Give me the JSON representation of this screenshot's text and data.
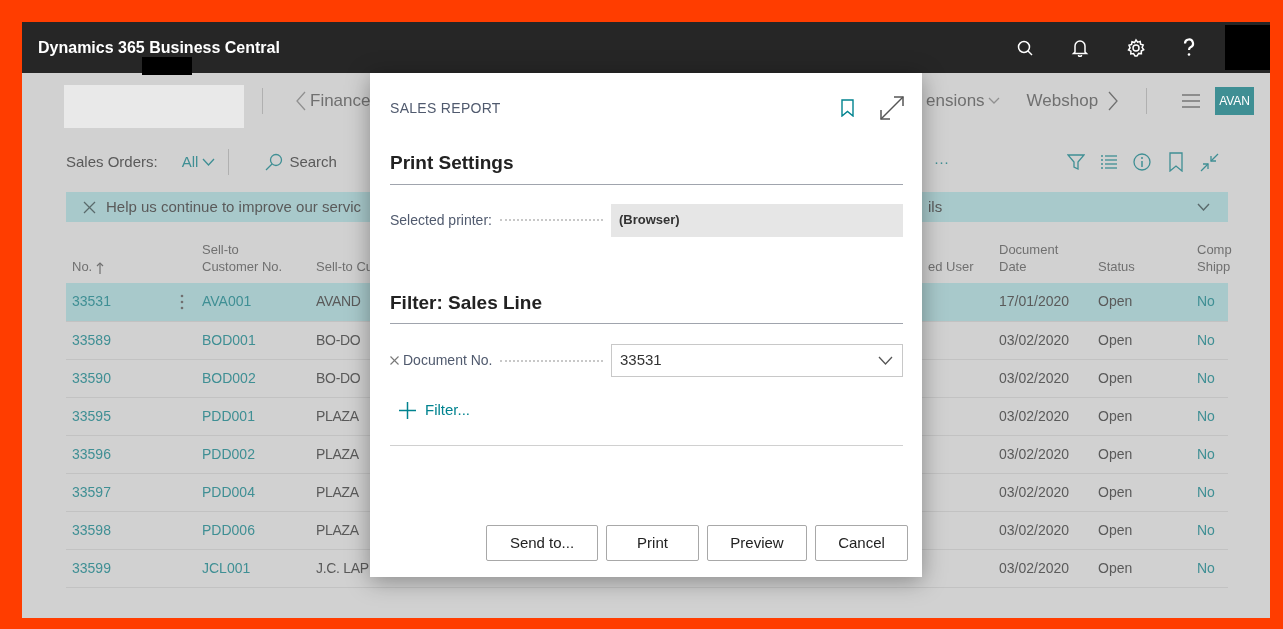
{
  "app_bar": {
    "title": "Dynamics 365 Business Central"
  },
  "nav": {
    "items": [
      {
        "label": "Finance",
        "kind": "prev"
      },
      {
        "label": "ensions",
        "kind": "menu"
      },
      {
        "label": "Webshop",
        "kind": "next"
      }
    ],
    "company_badge": "AVAN"
  },
  "action_bar": {
    "page_title": "Sales Orders:",
    "view": "All",
    "search": "Search",
    "more": "···"
  },
  "notification": {
    "text": "Help us continue to improve our servic",
    "text_end": "ils"
  },
  "table": {
    "columns": [
      {
        "label": "No.",
        "sorted": true
      },
      {
        "label": "Sell-to Customer No."
      },
      {
        "label": "Sell-to Cu"
      },
      {
        "label": "ed User"
      },
      {
        "label": "Document Date"
      },
      {
        "label": "Status"
      },
      {
        "label": "Comp Shipp"
      }
    ],
    "rows": [
      {
        "no": "33531",
        "customer_no": "AVA001",
        "column_3": "AVAND",
        "document_date": "17/01/2020",
        "status": "Open",
        "column_7": "No",
        "selected": true
      },
      {
        "no": "33589",
        "customer_no": "BOD001",
        "column_3": "BO-DO",
        "document_date": "03/02/2020",
        "status": "Open",
        "column_7": "No",
        "selected": false
      },
      {
        "no": "33590",
        "customer_no": "BOD002",
        "column_3": "BO-DO",
        "document_date": "03/02/2020",
        "status": "Open",
        "column_7": "No",
        "selected": false
      },
      {
        "no": "33595",
        "customer_no": "PDD001",
        "column_3": "PLAZA",
        "document_date": "03/02/2020",
        "status": "Open",
        "column_7": "No",
        "selected": false
      },
      {
        "no": "33596",
        "customer_no": "PDD002",
        "column_3": "PLAZA",
        "document_date": "03/02/2020",
        "status": "Open",
        "column_7": "No",
        "selected": false
      },
      {
        "no": "33597",
        "customer_no": "PDD004",
        "column_3": "PLAZA",
        "document_date": "03/02/2020",
        "status": "Open",
        "column_7": "No",
        "selected": false
      },
      {
        "no": "33598",
        "customer_no": "PDD006",
        "column_3": "PLAZA",
        "document_date": "03/02/2020",
        "status": "Open",
        "column_7": "No",
        "selected": false
      },
      {
        "no": "33599",
        "customer_no": "JCL001",
        "column_3": "J.C. LAP",
        "document_date": "03/02/2020",
        "status": "Open",
        "column_7": "No",
        "selected": false
      }
    ]
  },
  "dialog": {
    "title": "SALES REPORT",
    "sections": [
      {
        "heading": "Print Settings",
        "fields": [
          {
            "label": "Selected printer:",
            "value": "(Browser)",
            "kind": "readonly",
            "removable": false
          }
        ]
      },
      {
        "heading": "Filter: Sales Line",
        "fields": [
          {
            "label": "Document No.",
            "value": "33531",
            "kind": "dropdown",
            "removable": true
          }
        ],
        "add_filter": "Filter..."
      }
    ],
    "buttons": [
      "Send to...",
      "Print",
      "Preview",
      "Cancel"
    ]
  }
}
